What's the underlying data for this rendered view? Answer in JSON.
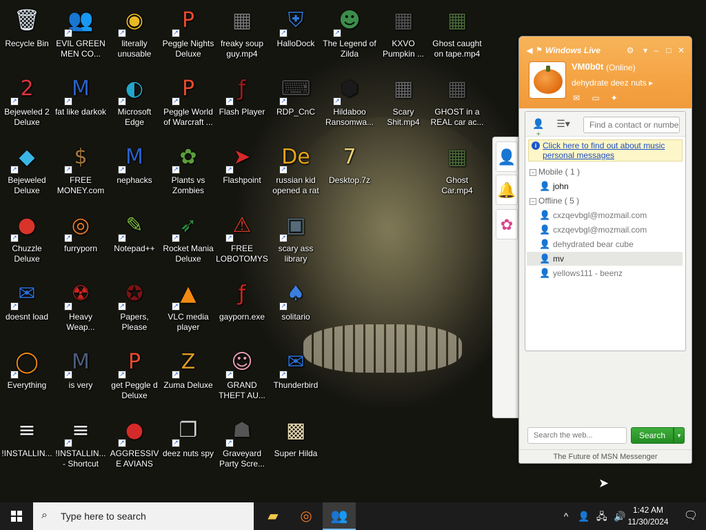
{
  "desktop": {
    "icons": [
      {
        "label": "Recycle Bin",
        "icon": "recycle-bin-icon",
        "glyph": "🗑",
        "color": "#dfe9f2",
        "shortcut": false
      },
      {
        "label": "EVIL GREEN MEN CO...",
        "icon": "evil-green-men-icon",
        "glyph": "👥",
        "color": "#3aa534",
        "shortcut": true
      },
      {
        "label": "literally unusable",
        "icon": "chrome-icon",
        "glyph": "◉",
        "color": "#e9b824",
        "shortcut": true
      },
      {
        "label": "Peggle Nights Deluxe",
        "icon": "peggle-icon",
        "glyph": "P",
        "color": "#e84a2c",
        "shortcut": true
      },
      {
        "label": "freaky soup guy.mp4",
        "icon": "video-file-icon",
        "glyph": "▦",
        "color": "#777",
        "shortcut": false
      },
      {
        "label": "HalloDock",
        "icon": "shield-icon",
        "glyph": "⛨",
        "color": "#2f7ad8",
        "shortcut": true
      },
      {
        "label": "The Legend of Zilda",
        "icon": "legend-zilda-icon",
        "glyph": "☻",
        "color": "#3c8c4a",
        "shortcut": true
      },
      {
        "label": "KXVO Pumpkin ...",
        "icon": "video-file-icon",
        "glyph": "▦",
        "color": "#555",
        "shortcut": false
      },
      {
        "label": "Ghost caught on tape.mp4",
        "icon": "video-file-icon",
        "glyph": "▦",
        "color": "#4a6a3a",
        "shortcut": false
      },
      {
        "label": "Bejeweled 2 Deluxe",
        "icon": "bejeweled-2-icon",
        "glyph": "2",
        "color": "#d8343d",
        "shortcut": true
      },
      {
        "label": "fat like darkok",
        "icon": "mpi-icon",
        "glyph": "M",
        "color": "#2a5fc8",
        "shortcut": true
      },
      {
        "label": "Microsoft Edge",
        "icon": "edge-icon",
        "glyph": "◐",
        "color": "#23a6c9",
        "shortcut": true
      },
      {
        "label": "Peggle World of Warcraft ...",
        "icon": "peggle-icon",
        "glyph": "P",
        "color": "#e84a2c",
        "shortcut": true
      },
      {
        "label": "Flash Player",
        "icon": "flash-icon",
        "glyph": "ƒ",
        "color": "#9e1b1b",
        "shortcut": true
      },
      {
        "label": "RDP_CnC",
        "icon": "rdp-icon",
        "glyph": "⌨",
        "color": "#444",
        "shortcut": true
      },
      {
        "label": "Hildaboo Ransomwa...",
        "icon": "ransomware-icon",
        "glyph": "⬢",
        "color": "#1a1a1a",
        "shortcut": true
      },
      {
        "label": "Scary Shit.mp4",
        "icon": "video-file-icon",
        "glyph": "▦",
        "color": "#666",
        "shortcut": false
      },
      {
        "label": "GHOST in a REAL car ac...",
        "icon": "video-file-icon",
        "glyph": "▦",
        "color": "#555",
        "shortcut": false
      },
      {
        "label": "Bejeweled Deluxe",
        "icon": "bejeweled-icon",
        "glyph": "◆",
        "color": "#3ab6e6",
        "shortcut": true
      },
      {
        "label": "FREE MONEY.com",
        "icon": "money-bag-icon",
        "glyph": "$",
        "color": "#a5763b",
        "shortcut": true
      },
      {
        "label": "nephacks",
        "icon": "mpi-icon",
        "glyph": "M",
        "color": "#2a5fc8",
        "shortcut": true
      },
      {
        "label": "Plants vs Zombies",
        "icon": "plants-zombies-icon",
        "glyph": "✿",
        "color": "#5a9e3a",
        "shortcut": true
      },
      {
        "label": "Flashpoint",
        "icon": "flashpoint-icon",
        "glyph": "➤",
        "color": "#d42a2a",
        "shortcut": true
      },
      {
        "label": "russian kid opened a rat",
        "icon": "de-icon",
        "glyph": "De",
        "color": "#e3a31a",
        "shortcut": true
      },
      {
        "label": "Desktop.7z",
        "icon": "archive-icon",
        "glyph": "7",
        "color": "#e8d170",
        "shortcut": false
      },
      {
        "label": "",
        "icon": "blank-icon",
        "glyph": "",
        "color": "transparent",
        "shortcut": false
      },
      {
        "label": "Ghost Car.mp4",
        "icon": "video-file-icon",
        "glyph": "▦",
        "color": "#4a6a3a",
        "shortcut": false
      },
      {
        "label": "Chuzzle Deluxe",
        "icon": "chuzzle-icon",
        "glyph": "●",
        "color": "#d9342a",
        "shortcut": true
      },
      {
        "label": "furryporn",
        "icon": "firefox-icon",
        "glyph": "◎",
        "color": "#f07a22",
        "shortcut": true
      },
      {
        "label": "Notepad++",
        "icon": "notepad-plus-icon",
        "glyph": "✎",
        "color": "#7fbf44",
        "shortcut": true
      },
      {
        "label": "Rocket Mania Deluxe",
        "icon": "rocket-mania-icon",
        "glyph": "➶",
        "color": "#2b8a3e",
        "shortcut": true
      },
      {
        "label": "FREE LOBOTOMYS",
        "icon": "lobotomy-icon",
        "glyph": "⚠",
        "color": "#d43a24",
        "shortcut": true
      },
      {
        "label": "scary ass library",
        "icon": "library-icon",
        "glyph": "▣",
        "color": "#556b7a",
        "shortcut": true
      },
      {
        "label": "doesnt load",
        "icon": "thunderbird-icon",
        "glyph": "✉",
        "color": "#2b6fd8",
        "shortcut": true
      },
      {
        "label": "Heavy Weap...",
        "icon": "heavy-weapon-icon",
        "glyph": "☢",
        "color": "#c8241e",
        "shortcut": true
      },
      {
        "label": "Papers, Please",
        "icon": "papers-please-icon",
        "glyph": "✪",
        "color": "#7a1414",
        "shortcut": true
      },
      {
        "label": "VLC media player",
        "icon": "vlc-icon",
        "glyph": "▲",
        "color": "#f08a12",
        "shortcut": true
      },
      {
        "label": "gayporn.exe",
        "icon": "flash-icon",
        "glyph": "ƒ",
        "color": "#c8241e",
        "shortcut": false
      },
      {
        "label": "solitario",
        "icon": "solitaire-icon",
        "glyph": "♠",
        "color": "#3b7ee0",
        "shortcut": true
      },
      {
        "label": "Everything",
        "icon": "everything-search-icon",
        "glyph": "◯",
        "color": "#f08a12",
        "shortcut": true
      },
      {
        "label": "is very",
        "icon": "mpi-shield-icon",
        "glyph": "M",
        "color": "#4c5c7a",
        "shortcut": true
      },
      {
        "label": "get Peggle d Deluxe",
        "icon": "peggle-icon",
        "glyph": "P",
        "color": "#e84a2c",
        "shortcut": true
      },
      {
        "label": "Zuma Deluxe",
        "icon": "zuma-icon",
        "glyph": "Z",
        "color": "#d99a22",
        "shortcut": true
      },
      {
        "label": "GRAND THEFT AU...",
        "icon": "anime-girl-icon",
        "glyph": "☺",
        "color": "#e39bb0",
        "shortcut": true
      },
      {
        "label": "Thunderbird",
        "icon": "thunderbird-icon",
        "glyph": "✉",
        "color": "#2b6fd8",
        "shortcut": true
      },
      {
        "label": "!INSTALLIN...",
        "icon": "text-file-icon",
        "glyph": "≡",
        "color": "#f4f4f4",
        "shortcut": false
      },
      {
        "label": "!INSTALLIN... - Shortcut",
        "icon": "text-file-icon",
        "glyph": "≡",
        "color": "#f4f4f4",
        "shortcut": true
      },
      {
        "label": "AGGRESSIVE AVIANS",
        "icon": "angry-bird-icon",
        "glyph": "●",
        "color": "#d42a2a",
        "shortcut": true
      },
      {
        "label": "deez nuts spy",
        "icon": "copy-windows-icon",
        "glyph": "❐",
        "color": "#cfcfcf",
        "shortcut": true
      },
      {
        "label": "Graveyard Party Scre...",
        "icon": "graveyard-icon",
        "glyph": "☗",
        "color": "#555",
        "shortcut": true
      },
      {
        "label": "Super Hilda",
        "icon": "super-hilda-icon",
        "glyph": "▩",
        "color": "#e6d9b0",
        "shortcut": false
      }
    ]
  },
  "msn": {
    "title": "Windows Live",
    "user_name": "VM0b0t",
    "user_status": "(Online)",
    "personal_message": "dehydrate deez nuts",
    "find_placeholder": "Find a contact or number...",
    "info_text": "Click here to find out about music personal messages",
    "groups": [
      {
        "name": "Mobile ( 1 )",
        "contacts": [
          {
            "name": "john",
            "status": "online"
          }
        ]
      },
      {
        "name": "Offline ( 5 )",
        "contacts": [
          {
            "name": "cxzqevbgl@mozmail.com",
            "status": "offline"
          },
          {
            "name": "cxzqevbgl@mozmail.com",
            "status": "offline"
          },
          {
            "name": "dehydrated bear cube",
            "status": "offline"
          },
          {
            "name": "mv",
            "status": "offline",
            "selected": true
          },
          {
            "name": "yellows111 - beenz",
            "status": "offline"
          }
        ]
      }
    ],
    "web_search_placeholder": "Search the web...",
    "search_button": "Search",
    "footer": "The Future of MSN Messenger"
  },
  "taskbar": {
    "search_placeholder": "Type here to search",
    "apps": [
      {
        "name": "file-explorer-icon",
        "glyph": "📁",
        "active": false
      },
      {
        "name": "firefox-icon",
        "glyph": "◎",
        "active": false
      },
      {
        "name": "msn-messenger-icon",
        "glyph": "👥",
        "active": true
      }
    ],
    "time": "1:42 AM",
    "date": "11/30/2024"
  },
  "colors": {
    "msn_header": "#f5a343",
    "search_green": "#228b22",
    "taskbar": "#1c1c1c"
  }
}
